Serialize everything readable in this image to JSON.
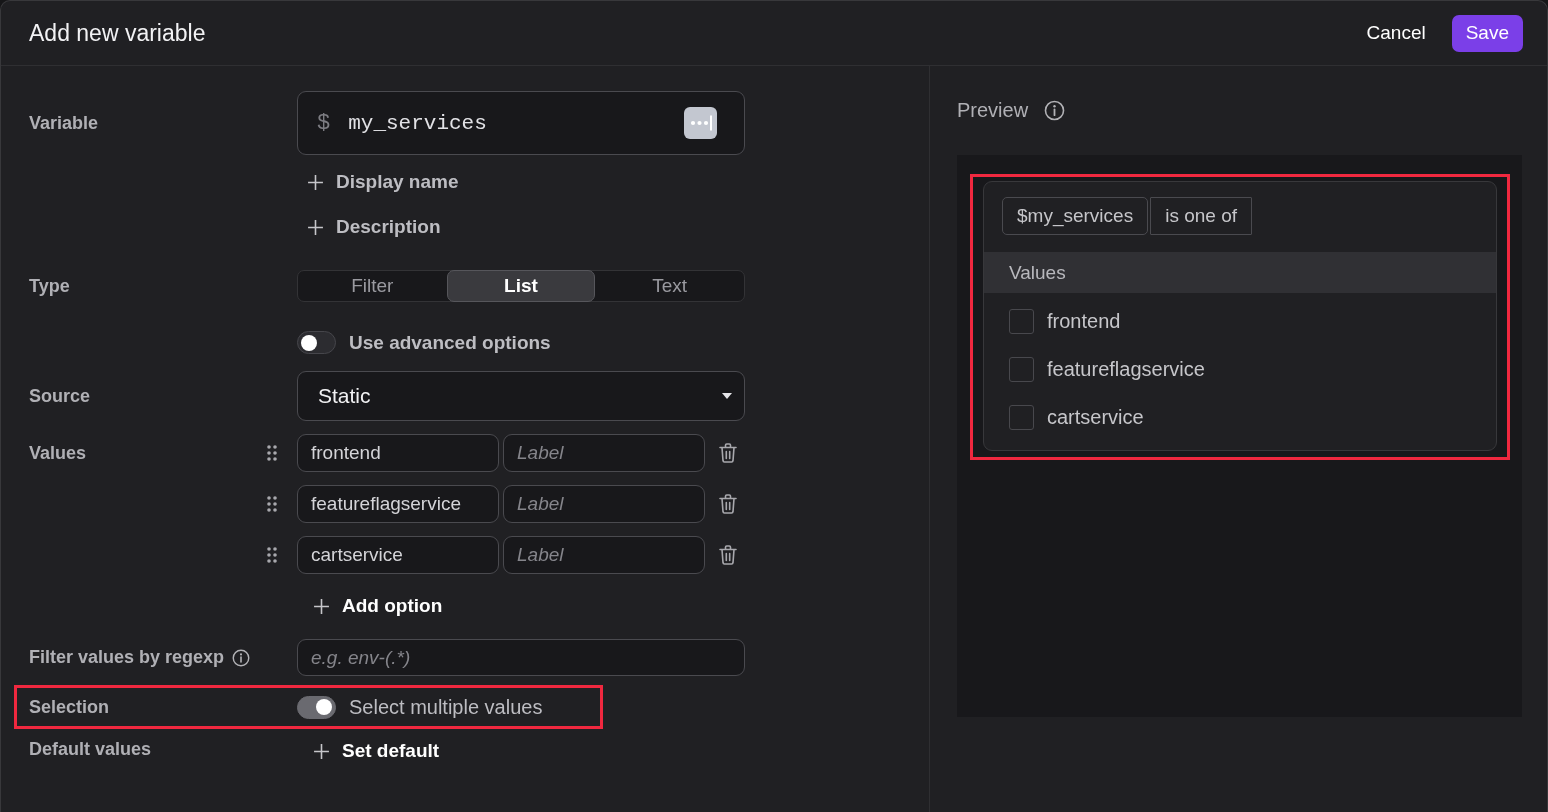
{
  "dialog": {
    "title": "Add new variable",
    "actions": [
      {
        "label": "Cancel",
        "kind": "text"
      },
      {
        "label": "Save",
        "kind": "primary"
      }
    ]
  },
  "form": {
    "variable": {
      "label": "Variable",
      "prefix": "$",
      "value": "my_services"
    },
    "optional_fields": [
      "Display name",
      "Description"
    ],
    "type": {
      "label": "Type",
      "options": [
        {
          "label": "Filter",
          "selected": false
        },
        {
          "label": "List",
          "selected": true
        },
        {
          "label": "Text",
          "selected": false
        }
      ]
    },
    "advanced_options": {
      "label": "Use advanced options",
      "on": false
    },
    "source": {
      "label": "Source",
      "value": "Static"
    },
    "values": {
      "label": "Values",
      "rows": [
        {
          "value": "frontend",
          "placeholder": "Label"
        },
        {
          "value": "featureflagservice",
          "placeholder": "Label"
        },
        {
          "value": "cartservice",
          "placeholder": "Label"
        }
      ],
      "add_label": "Add option"
    },
    "regexp": {
      "label": "Filter values by regexp",
      "placeholder": "e.g. env-(.*)"
    },
    "selection": {
      "label": "Selection",
      "toggle_label": "Select multiple values",
      "on": true,
      "highlighted": true
    },
    "default_values": {
      "label": "Default values",
      "action": "Set default"
    }
  },
  "preview": {
    "title": "Preview",
    "highlighted": true,
    "chips": [
      {
        "text": "$my_services",
        "kind": "variable"
      },
      {
        "text": "is one of",
        "kind": "operator"
      }
    ],
    "list_header": "Values",
    "options": [
      {
        "label": "frontend",
        "checked": false
      },
      {
        "label": "featureflagservice",
        "checked": false
      },
      {
        "label": "cartservice",
        "checked": false
      }
    ]
  }
}
